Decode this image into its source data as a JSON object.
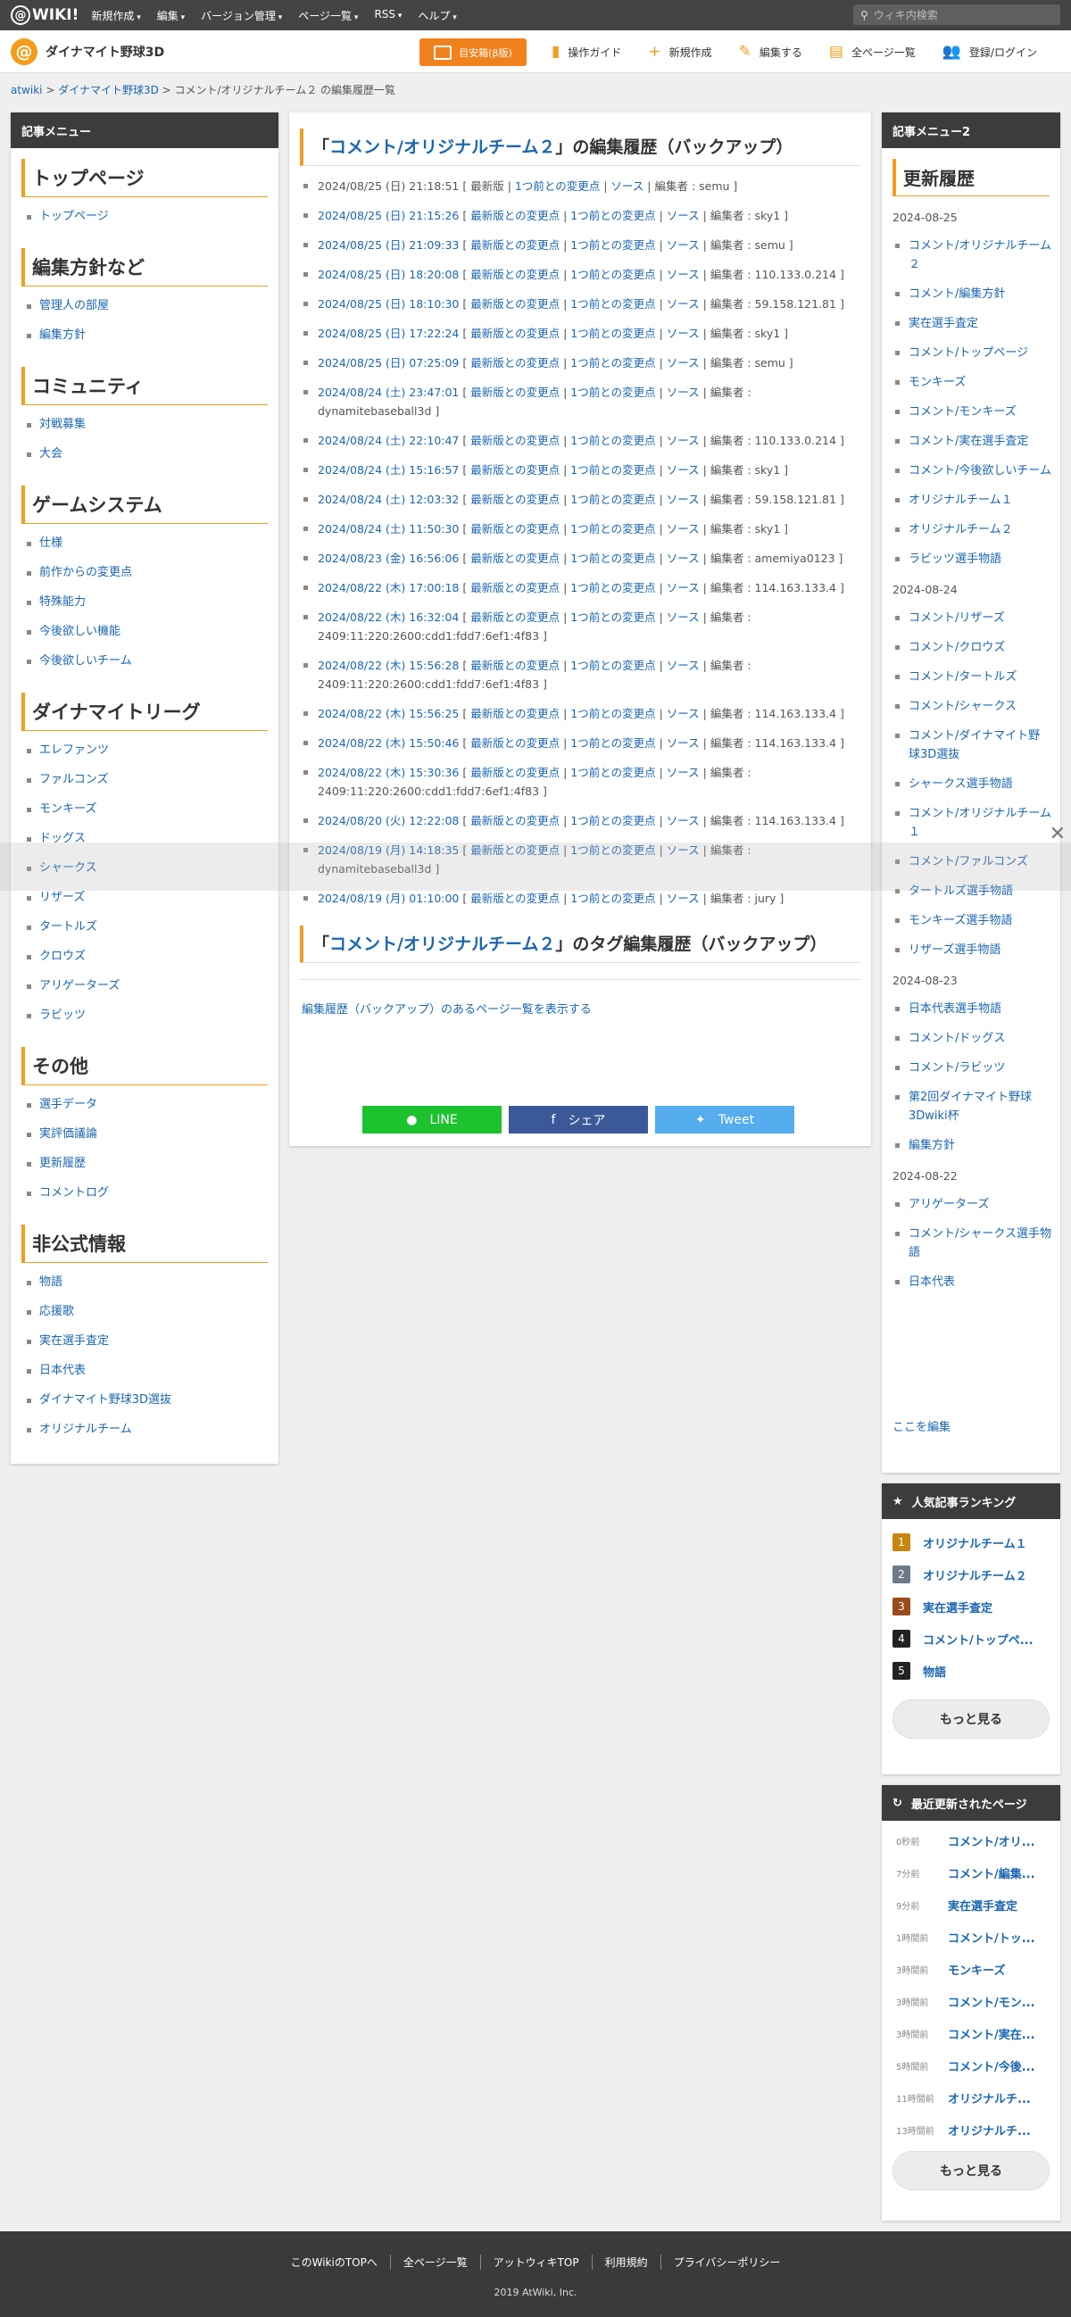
{
  "topbar": {
    "logo": "WIKI!",
    "menu": [
      "新規作成",
      "編集",
      "バージョン管理",
      "ページ一覧",
      "RSS",
      "ヘルプ"
    ],
    "search_placeholder": "ウィキ内検索"
  },
  "header": {
    "site_name": "ダイナマイト野球3D",
    "btn": "目安箱(β版)",
    "nav": [
      "操作ガイド",
      "新規作成",
      "編集する",
      "全ページ一覧",
      "登録/ログイン"
    ]
  },
  "breadcrumb": {
    "home": "atwiki",
    "sep1": " > ",
    "site": "ダイナマイト野球3D",
    "rest": " > コメント/オリジナルチーム２ の編集履歴一覧"
  },
  "left": {
    "title": "記事メニュー",
    "sections": [
      {
        "h": "トップページ",
        "items": [
          "トップページ"
        ]
      },
      {
        "h": "編集方針など",
        "items": [
          "管理人の部屋",
          "編集方針"
        ]
      },
      {
        "h": "コミュニティ",
        "items": [
          "対戦募集",
          "大会"
        ]
      },
      {
        "h": "ゲームシステム",
        "items": [
          "仕様",
          "前作からの変更点",
          "特殊能力",
          "今後欲しい機能",
          "今後欲しいチーム"
        ]
      },
      {
        "h": "ダイナマイトリーグ",
        "items": [
          "エレファンツ",
          "ファルコンズ",
          "モンキーズ",
          "ドッグス",
          "シャークス",
          "リザーズ",
          "タートルズ",
          "クロウズ",
          "アリゲーターズ",
          "ラビッツ"
        ]
      },
      {
        "h": "その他",
        "items": [
          "選手データ",
          "実評価議論",
          "更新履歴",
          "コメントログ"
        ]
      },
      {
        "h": "非公式情報",
        "items": [
          "物語",
          "応援歌",
          "実在選手査定",
          "日本代表",
          "ダイナマイト野球3D選抜",
          "オリジナルチーム"
        ]
      }
    ]
  },
  "main": {
    "title_pre": "「",
    "title_link": "コメント/オリジナルチーム２",
    "title_post": "」の編集履歴（バックアップ）",
    "history": [
      {
        "date": "2024/08/25 (日) 21:18:51",
        "diff": "最新版",
        "prev": "1つ前との変更点",
        "src": "ソース",
        "editor": "編集者 : semu"
      },
      {
        "date": "2024/08/25 (日) 21:15:26",
        "diff": "最新版との変更点",
        "prev": "1つ前との変更点",
        "src": "ソース",
        "editor": "編集者 : sky1"
      },
      {
        "date": "2024/08/25 (日) 21:09:33",
        "diff": "最新版との変更点",
        "prev": "1つ前との変更点",
        "src": "ソース",
        "editor": "編集者 : semu"
      },
      {
        "date": "2024/08/25 (日) 18:20:08",
        "diff": "最新版との変更点",
        "prev": "1つ前との変更点",
        "src": "ソース",
        "editor": "編集者 : 110.133.0.214"
      },
      {
        "date": "2024/08/25 (日) 18:10:30",
        "diff": "最新版との変更点",
        "prev": "1つ前との変更点",
        "src": "ソース",
        "editor": "編集者 : 59.158.121.81"
      },
      {
        "date": "2024/08/25 (日) 17:22:24",
        "diff": "最新版との変更点",
        "prev": "1つ前との変更点",
        "src": "ソース",
        "editor": "編集者 : sky1"
      },
      {
        "date": "2024/08/25 (日) 07:25:09",
        "diff": "最新版との変更点",
        "prev": "1つ前との変更点",
        "src": "ソース",
        "editor": "編集者 : semu"
      },
      {
        "date": "2024/08/24 (土) 23:47:01",
        "diff": "最新版との変更点",
        "prev": "1つ前との変更点",
        "src": "ソース",
        "editor": "編集者 : dynamitebaseball3d"
      },
      {
        "date": "2024/08/24 (土) 22:10:47",
        "diff": "最新版との変更点",
        "prev": "1つ前との変更点",
        "src": "ソース",
        "editor": "編集者 : 110.133.0.214"
      },
      {
        "date": "2024/08/24 (土) 15:16:57",
        "diff": "最新版との変更点",
        "prev": "1つ前との変更点",
        "src": "ソース",
        "editor": "編集者 : sky1"
      },
      {
        "date": "2024/08/24 (土) 12:03:32",
        "diff": "最新版との変更点",
        "prev": "1つ前との変更点",
        "src": "ソース",
        "editor": "編集者 : 59.158.121.81"
      },
      {
        "date": "2024/08/24 (土) 11:50:30",
        "diff": "最新版との変更点",
        "prev": "1つ前との変更点",
        "src": "ソース",
        "editor": "編集者 : sky1"
      },
      {
        "date": "2024/08/23 (金) 16:56:06",
        "diff": "最新版との変更点",
        "prev": "1つ前との変更点",
        "src": "ソース",
        "editor": "編集者 : amemiya0123"
      },
      {
        "date": "2024/08/22 (木) 17:00:18",
        "diff": "最新版との変更点",
        "prev": "1つ前との変更点",
        "src": "ソース",
        "editor": "編集者 : 114.163.133.4"
      },
      {
        "date": "2024/08/22 (木) 16:32:04",
        "diff": "最新版との変更点",
        "prev": "1つ前との変更点",
        "src": "ソース",
        "editor": "編集者 : 2409:11:220:2600:cdd1:fdd7:6ef1:4f83"
      },
      {
        "date": "2024/08/22 (木) 15:56:28",
        "diff": "最新版との変更点",
        "prev": "1つ前との変更点",
        "src": "ソース",
        "editor": "編集者 : 2409:11:220:2600:cdd1:fdd7:6ef1:4f83"
      },
      {
        "date": "2024/08/22 (木) 15:56:25",
        "diff": "最新版との変更点",
        "prev": "1つ前との変更点",
        "src": "ソース",
        "editor": "編集者 : 114.163.133.4"
      },
      {
        "date": "2024/08/22 (木) 15:50:46",
        "diff": "最新版との変更点",
        "prev": "1つ前との変更点",
        "src": "ソース",
        "editor": "編集者 : 114.163.133.4"
      },
      {
        "date": "2024/08/22 (木) 15:30:36",
        "diff": "最新版との変更点",
        "prev": "1つ前との変更点",
        "src": "ソース",
        "editor": "編集者 : 2409:11:220:2600:cdd1:fdd7:6ef1:4f83"
      },
      {
        "date": "2024/08/20 (火) 12:22:08",
        "diff": "最新版との変更点",
        "prev": "1つ前との変更点",
        "src": "ソース",
        "editor": "編集者 : 114.163.133.4"
      },
      {
        "date": "2024/08/19 (月) 14:18:35",
        "diff": "最新版との変更点",
        "prev": "1つ前との変更点",
        "src": "ソース",
        "editor": "編集者 : dynamitebaseball3d"
      },
      {
        "date": "2024/08/19 (月) 01:10:00",
        "diff": "最新版との変更点",
        "prev": "1つ前との変更点",
        "src": "ソース",
        "editor": "編集者 : jury"
      }
    ],
    "tag_title_pre": "「",
    "tag_title_link": "コメント/オリジナルチーム２",
    "tag_title_post": "」のタグ編集履歴（バックアップ）",
    "backup_link": "編集履歴（バックアップ）のあるページ一覧を表示する",
    "share": {
      "line": "LINE",
      "facebook": "シェア",
      "twitter": "Tweet"
    }
  },
  "right": {
    "title": "記事メニュー2",
    "heading": "更新履歴",
    "groups": [
      {
        "date": "2024-08-25",
        "items": [
          "コメント/オリジナルチーム２",
          "コメント/編集方針",
          "実在選手査定",
          "コメント/トップページ",
          "モンキーズ",
          "コメント/モンキーズ",
          "コメント/実在選手査定",
          "コメント/今後欲しいチーム",
          "オリジナルチーム１",
          "オリジナルチーム２",
          "ラビッツ選手物語"
        ]
      },
      {
        "date": "2024-08-24",
        "items": [
          "コメント/リザーズ",
          "コメント/クロウズ",
          "コメント/タートルズ",
          "コメント/シャークス",
          "コメント/ダイナマイト野球3D選抜",
          "シャークス選手物語",
          "コメント/オリジナルチーム１",
          "コメント/ファルコンズ",
          "タートルズ選手物語",
          "モンキーズ選手物語",
          "リザーズ選手物語"
        ]
      },
      {
        "date": "2024-08-23",
        "items": [
          "日本代表選手物語",
          "コメント/ドッグス",
          "コメント/ラビッツ",
          "第2回ダイナマイト野球3Dwiki杯",
          "編集方針"
        ]
      },
      {
        "date": "2024-08-22",
        "items": [
          "アリゲーターズ",
          "コメント/シャークス選手物語",
          "日本代表"
        ]
      }
    ],
    "edit": "ここを編集"
  },
  "ranking": {
    "title": "人気記事ランキング",
    "items": [
      {
        "n": "1",
        "name": "オリジナルチーム１",
        "color": "#c8860e"
      },
      {
        "n": "2",
        "name": "オリジナルチーム２",
        "color": "#6b7a86"
      },
      {
        "n": "3",
        "name": "実在選手査定",
        "color": "#9a4a1c"
      },
      {
        "n": "4",
        "name": "コメント/トップペ...",
        "color": "#222222"
      },
      {
        "n": "5",
        "name": "物語",
        "color": "#222222"
      }
    ],
    "more": "もっと見る"
  },
  "recent": {
    "title": "最近更新されたページ",
    "items": [
      {
        "t": "0秒前",
        "name": "コメント/オリ..."
      },
      {
        "t": "7分前",
        "name": "コメント/編集..."
      },
      {
        "t": "9分前",
        "name": "実在選手査定"
      },
      {
        "t": "1時間前",
        "name": "コメント/トッ..."
      },
      {
        "t": "3時間前",
        "name": "モンキーズ"
      },
      {
        "t": "3時間前",
        "name": "コメント/モン..."
      },
      {
        "t": "3時間前",
        "name": "コメント/実在..."
      },
      {
        "t": "5時間前",
        "name": "コメント/今後..."
      },
      {
        "t": "11時間前",
        "name": "オリジナルチ..."
      },
      {
        "t": "13時間前",
        "name": "オリジナルチ..."
      }
    ],
    "more": "もっと見る"
  },
  "footer": {
    "links": [
      "このWikiのTOPへ",
      "全ページ一覧",
      "アットウィキTOP",
      "利用規約",
      "プライバシーポリシー"
    ],
    "copy": "2019 AtWiki, Inc."
  }
}
